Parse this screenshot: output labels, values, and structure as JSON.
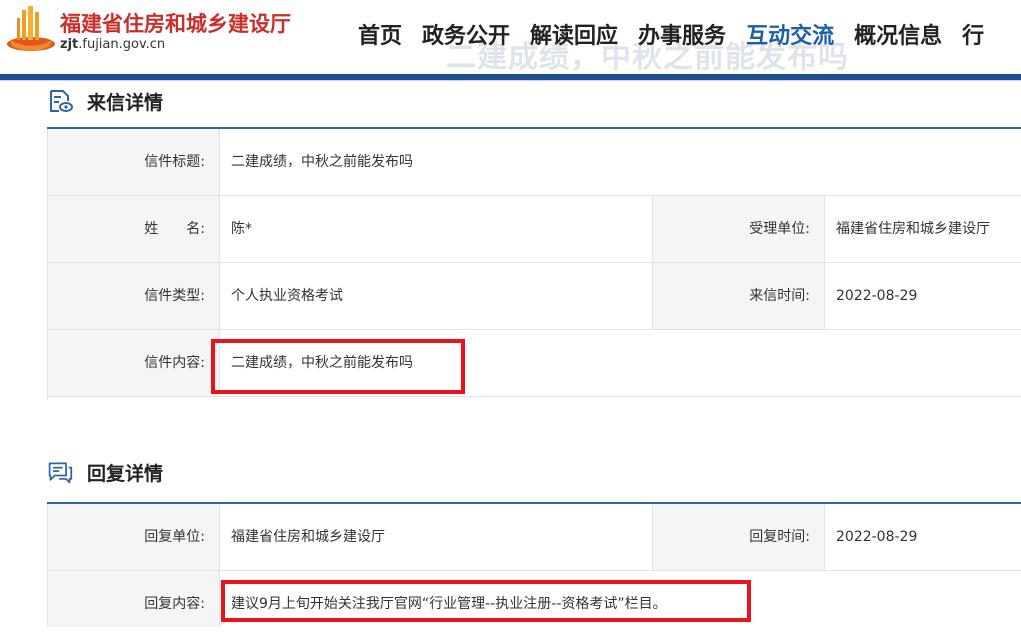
{
  "header": {
    "site_name": "福建省住房和城乡建设厅",
    "domain_bold": "zjt",
    "domain_rest": ".fujian.gov.cn",
    "ghost_title": "二建成绩，中秋之前能发布吗",
    "nav": [
      "首页",
      "政务公开",
      "解读回应",
      "办事服务",
      "互动交流",
      "概况信息",
      "行"
    ],
    "active_nav": "互动交流"
  },
  "letter": {
    "section_title": "来信详情",
    "title_label": "信件标题:",
    "title_value": "二建成绩，中秋之前能发布吗",
    "name_label": "姓　　名:",
    "name_value": "陈*",
    "unit_label": "受理单位:",
    "unit_value": "福建省住房和城乡建设厅",
    "type_label": "信件类型:",
    "type_value": "个人执业资格考试",
    "date_label": "来信时间:",
    "date_value": "2022-08-29",
    "content_label": "信件内容:",
    "content_value": "二建成绩，中秋之前能发布吗"
  },
  "reply": {
    "section_title": "回复详情",
    "unit_label": "回复单位:",
    "unit_value": "福建省住房和城乡建设厅",
    "date_label": "回复时间:",
    "date_value": "2022-08-29",
    "content_label": "回复内容:",
    "content_value": "建议9月上旬开始关注我厅官网“行业管理--执业注册--资格考试”栏目。"
  },
  "colors": {
    "brand_blue": "#1f4f95",
    "highlight_red": "#e8131b",
    "site_name_red": "#c9302c"
  }
}
